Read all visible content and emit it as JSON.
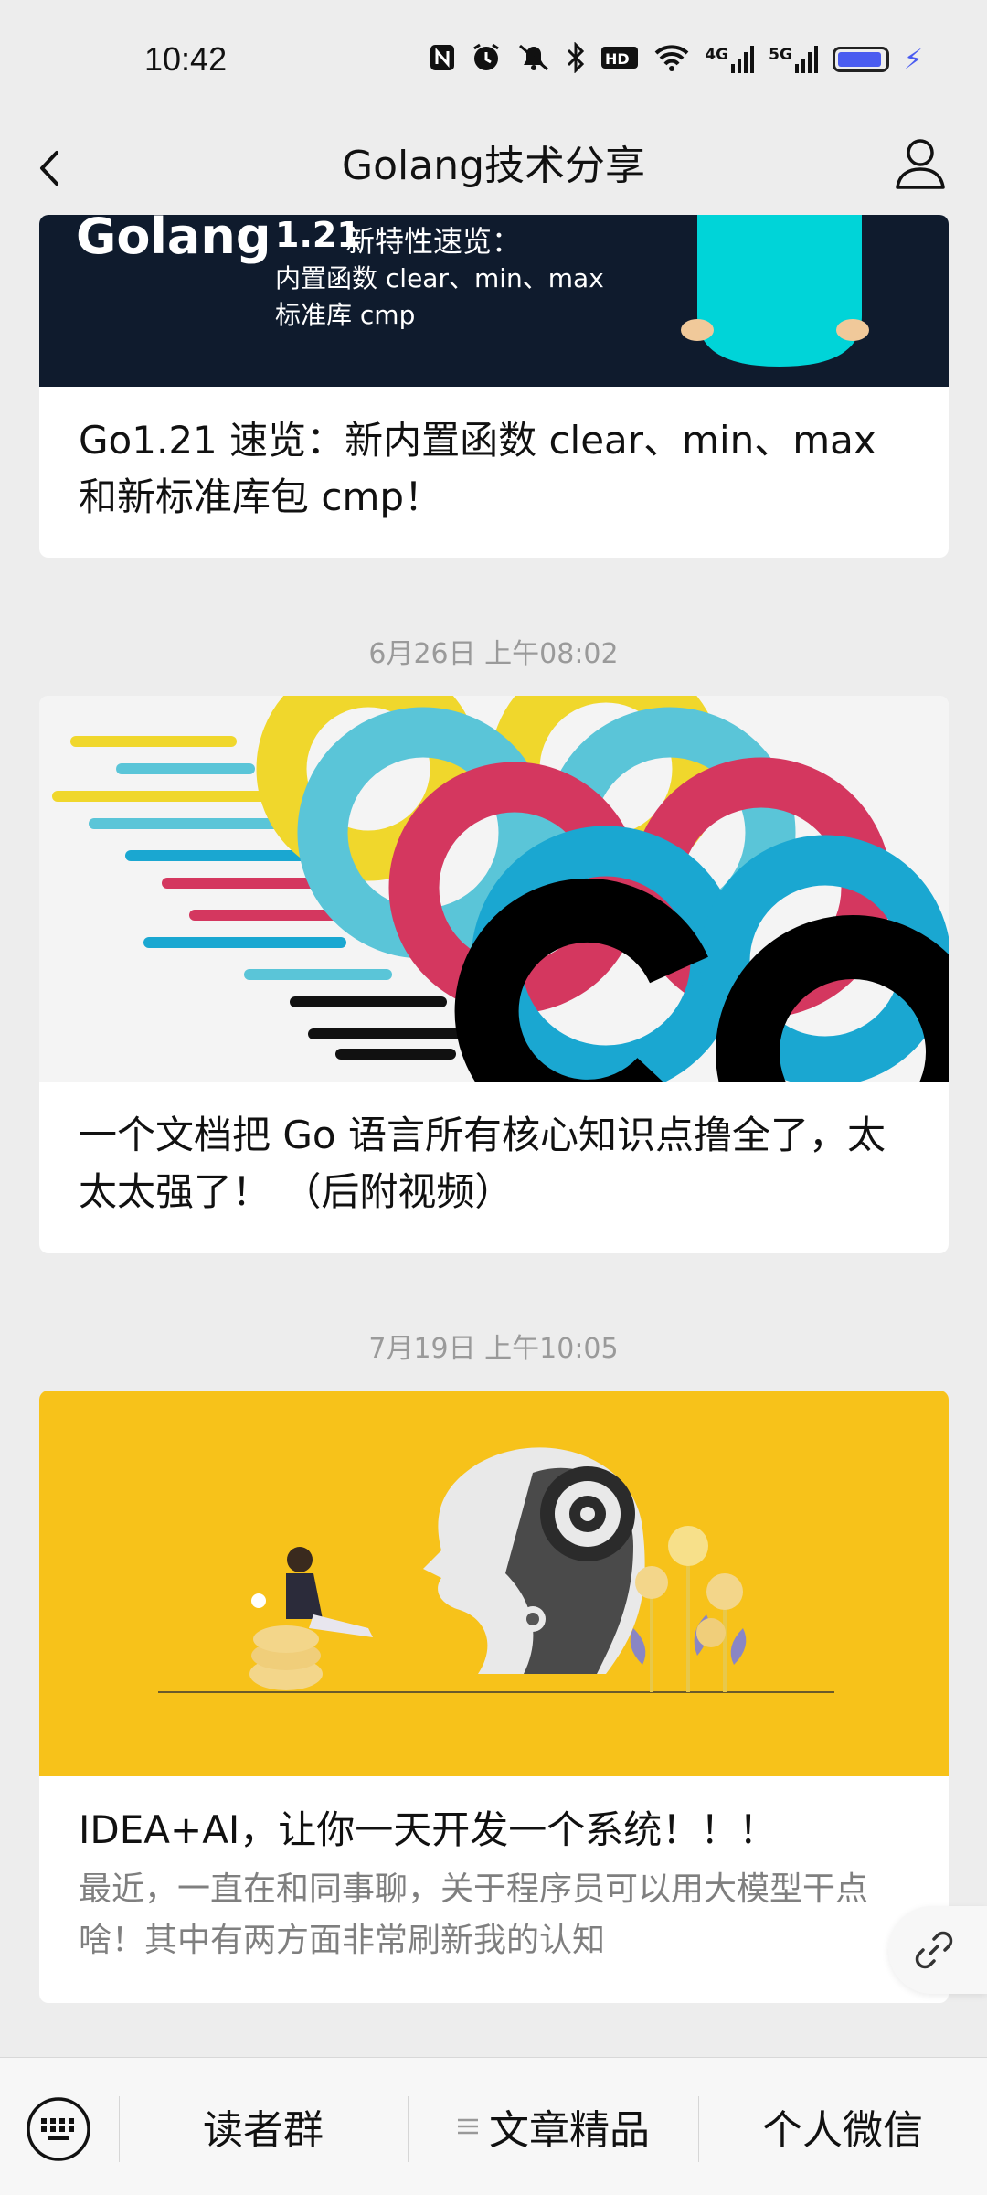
{
  "status_bar": {
    "time": "10:42",
    "icons": [
      "nfc-icon",
      "alarm-icon",
      "mute-icon",
      "bluetooth-icon",
      "hd-icon",
      "wifi-icon",
      "signal-4g-icon",
      "signal-5g-icon",
      "battery-icon",
      "charging-icon"
    ],
    "net1": "4G",
    "net2": "5G",
    "hd": "HD"
  },
  "nav": {
    "title": "Golang技术分享"
  },
  "cards": [
    {
      "image_text": {
        "logo": "Golang",
        "version": "1.21",
        "line1": "新特性速览：",
        "line2": "内置函数 clear、min、max",
        "line3": "标准库 cmp"
      },
      "title": "Go1.21 速览：新内置函数 clear、min、max和新标准库包 cmp！"
    },
    {
      "timestamp": "6月26日 上午08:02",
      "title": "一个文档把 Go 语言所有核心知识点撸全了，太太太强了！ （后附视频）"
    },
    {
      "timestamp": "7月19日 上午10:05",
      "title": "IDEA+AI，让你一天开发一个系统！！！",
      "description": "最近，一直在和同事聊，关于程序员可以用大模型干点啥！其中有两方面非常刷新我的认知"
    }
  ],
  "bottom_menu": {
    "item1": "读者群",
    "item2": "文章精品",
    "item3": "个人微信"
  },
  "colors": {
    "background": "#ededed",
    "card_bg": "#ffffff",
    "golang_banner": "#0f1b2d",
    "gopher": "#00d4d8",
    "ai_banner": "#f7c21a",
    "go_red": "#d4375f",
    "go_blue": "#1aa7d1",
    "go_yellow": "#f0d72c"
  }
}
